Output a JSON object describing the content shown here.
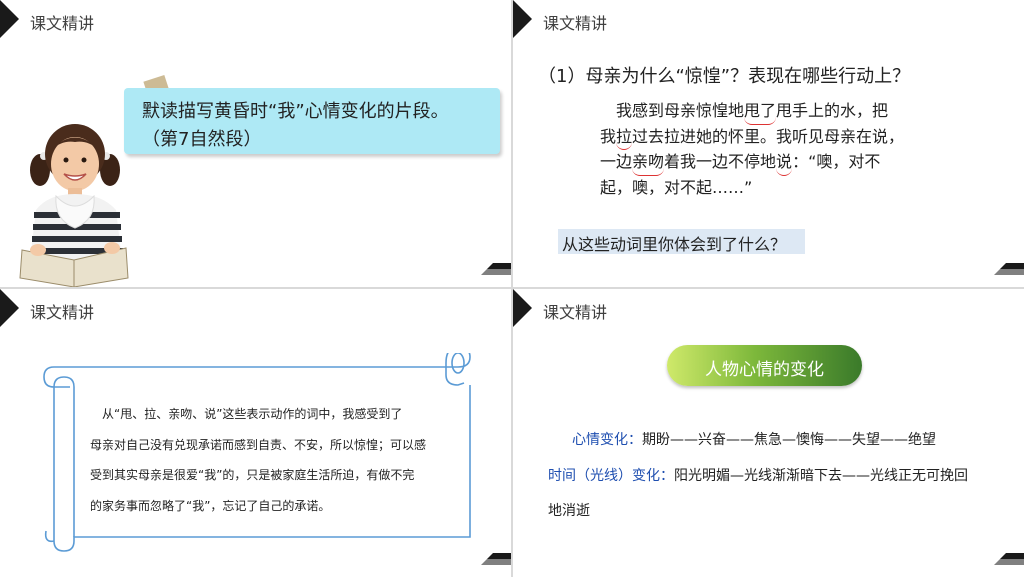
{
  "slide1": {
    "header": "课文精讲",
    "bubble_line1": "默读描写黄昏时“我”心情变化的片段。",
    "bubble_line2": "（第7自然段）"
  },
  "slide2": {
    "header": "课文精讲",
    "question": "（1）母亲为什么“惊惶”？表现在哪些行动上？",
    "lines": {
      "l1_a": "我感到母亲惊惶地",
      "l1_m": "甩了",
      "l1_b": "甩手上的水，把",
      "l2_a": "我",
      "l2_m": "拉",
      "l2_b": "过去拉进她的怀里。我听见母亲在说，",
      "l3_a": "一边",
      "l3_m": "亲吻",
      "l3_b": "着我一边不停地",
      "l3_m2": "说",
      "l3_c": "：“噢，对不",
      "l4": "起，噢，对不起……”"
    },
    "highlight": "从这些动词里你体会到了什么？"
  },
  "slide3": {
    "header": "课文精讲",
    "lines": [
      "从“甩、拉、亲吻、说”这些表示动作的词中，我感受到了",
      "母亲对自己没有兑现承诺而感到自责、不安，所以惊惶；可以感",
      "受到其实母亲是很爱“我”的，只是被家庭生活所迫，有做不完",
      "的家务事而忽略了“我”，忘记了自己的承诺。"
    ]
  },
  "slide4": {
    "header": "课文精讲",
    "pill": "人物心情的变化",
    "mood_label": "心情变化：",
    "mood_value": "期盼——兴奋——焦急—懊悔——失望——绝望",
    "time_label": "时间（光线）变化：",
    "time_value": "阳光明媚—光线渐渐暗下去——光线正无可挽回",
    "time_value2": "地消逝"
  },
  "colors": {
    "bubble": "#aee9f5",
    "highlight": "#dde8f4",
    "label_blue": "#1f4fb0",
    "scroll_border": "#5b9bd5"
  }
}
